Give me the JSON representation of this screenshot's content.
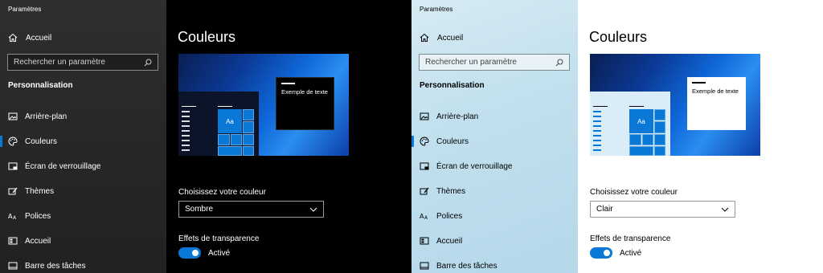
{
  "colors": {
    "accent": "#0a78d7",
    "dark_bg": "#000000",
    "dark_sidebar": "#2b2b2b",
    "light_bg": "#ffffff",
    "light_sidebar": "#c6e3ef"
  },
  "panels": {
    "dark": {
      "window_title": "Paramètres",
      "home_label": "Accueil",
      "search_placeholder": "Rechercher un paramètre",
      "section_title": "Personnalisation",
      "nav": [
        {
          "label": "Arrière-plan",
          "icon": "image-icon"
        },
        {
          "label": "Couleurs",
          "icon": "palette-icon",
          "selected": true
        },
        {
          "label": "Écran de verrouillage",
          "icon": "lock-screen-icon"
        },
        {
          "label": "Thèmes",
          "icon": "brush-icon"
        },
        {
          "label": "Polices",
          "icon": "font-icon"
        },
        {
          "label": "Accueil",
          "icon": "start-menu-icon"
        },
        {
          "label": "Barre des tâches",
          "icon": "taskbar-icon"
        }
      ],
      "page_title": "Couleurs",
      "preview_text": "Exemple de texte",
      "preview_tile": "Aa",
      "color_label": "Choisissez votre couleur",
      "color_value": "Sombre",
      "transparency_label": "Effets de transparence",
      "transparency_state": "Activé"
    },
    "light": {
      "window_title": "Paramètres",
      "home_label": "Accueil",
      "search_placeholder": "Rechercher un paramètre",
      "section_title": "Personnalisation",
      "nav": [
        {
          "label": "Arrière-plan",
          "icon": "image-icon"
        },
        {
          "label": "Couleurs",
          "icon": "palette-icon",
          "selected": true
        },
        {
          "label": "Écran de verrouillage",
          "icon": "lock-screen-icon"
        },
        {
          "label": "Thèmes",
          "icon": "brush-icon"
        },
        {
          "label": "Polices",
          "icon": "font-icon"
        },
        {
          "label": "Accueil",
          "icon": "start-menu-icon"
        },
        {
          "label": "Barre des tâches",
          "icon": "taskbar-icon"
        }
      ],
      "page_title": "Couleurs",
      "preview_text": "Exemple de texte",
      "preview_tile": "Aa",
      "color_label": "Choisissez votre couleur",
      "color_value": "Clair",
      "transparency_label": "Effets de transparence",
      "transparency_state": "Activé"
    }
  }
}
